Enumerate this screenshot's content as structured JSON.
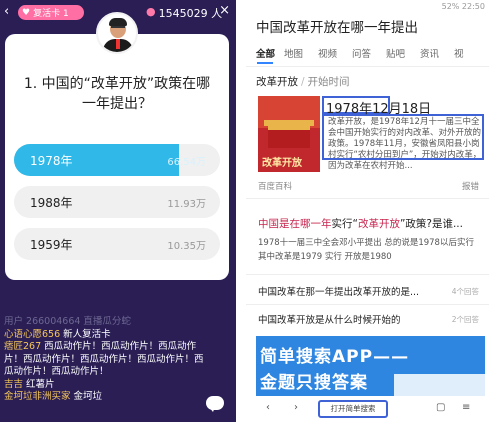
{
  "left": {
    "topbar": {
      "back": "‹",
      "revive_card": "复活卡 1",
      "viewers": "1545029 人",
      "close": "×"
    },
    "question": "1. 中国的“改革开放”政策在哪一年提出？",
    "options": [
      {
        "label": "1978年",
        "count": "66.54万",
        "ratio": 0.8,
        "selected": true
      },
      {
        "label": "1988年",
        "count": "11.93万",
        "ratio": 0.15,
        "selected": false
      },
      {
        "label": "1959年",
        "count": "10.35万",
        "ratio": 0.12,
        "selected": false
      }
    ],
    "chat": [
      {
        "text": "用户 266004664 直播瓜分蛇",
        "faded": true
      },
      {
        "nick": "心语心愿656",
        "text": " 新人复活卡"
      },
      {
        "nick": "痞匠267",
        "text": " 西瓜动作片！西瓜动作片！西瓜动作片！西瓜动作片！西瓜动作片！西瓜动作片！西瓜动作片！西瓜动作片！"
      },
      {
        "nick": "吉吉",
        "text": " 红薯片"
      },
      {
        "nick": "金坷垃非洲买家",
        "text": " 金坷垃"
      }
    ]
  },
  "right": {
    "status_left": "",
    "status_right": "52% 22:50",
    "page_title": "中国改革开放在哪一年提出",
    "tabs": [
      "全部",
      "地图",
      "视频",
      "问答",
      "贴吧",
      "资讯",
      "视"
    ],
    "breadcrumb_main": "改革开放",
    "breadcrumb_sub": "开始时间",
    "image_caption": "改革开放",
    "answer_date": "1978年12月18日",
    "snippet": "改革开放，是1978年12月十一届三中全会中国开始实行的对内改革、对外开放的政策。1978年11月，安徽省凤阳县小岗村实行“农村分田到户”，开始对内改革，因为改革在农村开始...",
    "source": "百度百科",
    "report": "报错",
    "result1_title_parts": [
      "中国是在哪一年",
      "实行“",
      "改革开放",
      "”政策?是谁..."
    ],
    "result1_body": "1978十一届三中全会邓小平提出 总的说是1978以后实行 其中改革是1979 实行 开放是1980",
    "result2_title": "中国改革在那一年提出改革开放的是...",
    "result2_meta": "4个回答",
    "result3_title": "中国改革开放是从什么时候开始的",
    "result3_meta": "2个回答",
    "banner_line1": "简单搜索APP——",
    "banner_line2": "金题只搜答案",
    "bottom_pill": "打开简单搜索",
    "accent": "#3f63d6"
  }
}
